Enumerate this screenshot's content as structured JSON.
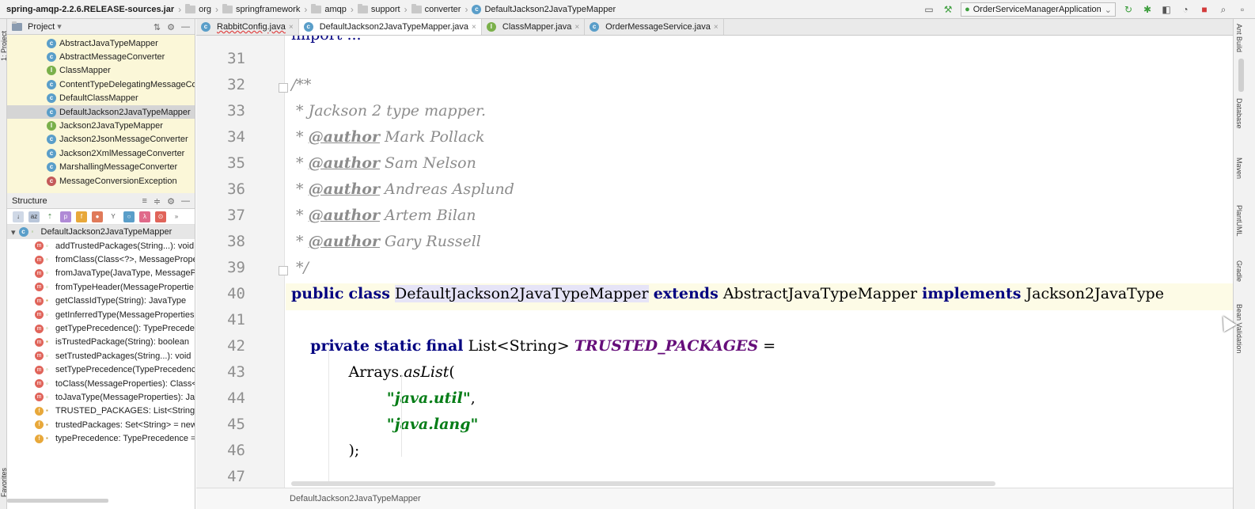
{
  "navbar": {
    "crumbs": [
      "spring-amqp-2.2.6.RELEASE-sources.jar",
      "org",
      "springframework",
      "amqp",
      "support",
      "converter",
      "DefaultJackson2JavaTypeMapper"
    ],
    "run_config": "OrderServiceManagerApplication"
  },
  "left_strip": {
    "top_tab": "1: Project",
    "bottom_tab": "Favorites"
  },
  "project_panel": {
    "title": "Project",
    "items": [
      {
        "label": "AbstractJavaTypeMapper",
        "kind": "class"
      },
      {
        "label": "AbstractMessageConverter",
        "kind": "class"
      },
      {
        "label": "ClassMapper",
        "kind": "interface"
      },
      {
        "label": "ContentTypeDelegatingMessageCon",
        "kind": "class"
      },
      {
        "label": "DefaultClassMapper",
        "kind": "class"
      },
      {
        "label": "DefaultJackson2JavaTypeMapper",
        "kind": "class",
        "selected": true
      },
      {
        "label": "Jackson2JavaTypeMapper",
        "kind": "interface"
      },
      {
        "label": "Jackson2JsonMessageConverter",
        "kind": "class"
      },
      {
        "label": "Jackson2XmlMessageConverter",
        "kind": "class"
      },
      {
        "label": "MarshallingMessageConverter",
        "kind": "class"
      },
      {
        "label": "MessageConversionException",
        "kind": "exception"
      }
    ]
  },
  "structure_panel": {
    "title": "Structure",
    "root": "DefaultJackson2JavaTypeMapper",
    "members": [
      {
        "label": "addTrustedPackages(String...): void",
        "kind": "m",
        "access": "public"
      },
      {
        "label": "fromClass(Class<?>, MessagePrope",
        "kind": "m",
        "access": "public"
      },
      {
        "label": "fromJavaType(JavaType, MessagePr",
        "kind": "m",
        "access": "public"
      },
      {
        "label": "fromTypeHeader(MessagePropertie",
        "kind": "m",
        "access": "public"
      },
      {
        "label": "getClassIdType(String): JavaType",
        "kind": "m",
        "access": "private"
      },
      {
        "label": "getInferredType(MessageProperties",
        "kind": "m",
        "access": "public"
      },
      {
        "label": "getTypePrecedence(): TypePrecedenc",
        "kind": "m",
        "access": "public"
      },
      {
        "label": "isTrustedPackage(String): boolean",
        "kind": "m",
        "access": "private"
      },
      {
        "label": "setTrustedPackages(String...): void",
        "kind": "m",
        "access": "public"
      },
      {
        "label": "setTypePrecedence(TypePrecedence",
        "kind": "m",
        "access": "public"
      },
      {
        "label": "toClass(MessageProperties): Class<",
        "kind": "m",
        "access": "public"
      },
      {
        "label": "toJavaType(MessageProperties): Jav",
        "kind": "m",
        "access": "public"
      },
      {
        "label": "TRUSTED_PACKAGES: List<String> =",
        "kind": "f",
        "access": "private"
      },
      {
        "label": "trustedPackages: Set<String> = new",
        "kind": "f",
        "access": "private"
      },
      {
        "label": "typePrecedence: TypePrecedence =",
        "kind": "f",
        "access": "private"
      }
    ]
  },
  "tabs": [
    {
      "label": "RabbitConfig.java",
      "kind": "class",
      "error": true
    },
    {
      "label": "DefaultJackson2JavaTypeMapper.java",
      "kind": "class",
      "active": true
    },
    {
      "label": "ClassMapper.java",
      "kind": "interface"
    },
    {
      "label": "OrderMessageService.java",
      "kind": "class"
    }
  ],
  "editor": {
    "partial_top_line": "import ...",
    "line_numbers": [
      "31",
      "32",
      "33",
      "34",
      "35",
      "36",
      "37",
      "38",
      "39",
      "40",
      "41",
      "42",
      "43",
      "44",
      "45",
      "46",
      "47"
    ],
    "javadoc_open": "/**",
    "javadoc_desc": " * Jackson 2 type mapper.",
    "author_tag": "@author",
    "authors": [
      "Mark Pollack",
      "Sam Nelson",
      "Andreas Asplund",
      "Artem Bilan",
      "Gary Russell"
    ],
    "javadoc_close": " */",
    "kw_public": "public",
    "kw_class": "class",
    "class_name": "DefaultJackson2JavaTypeMapper",
    "kw_extends": "extends",
    "super_class": "AbstractJavaTypeMapper",
    "kw_implements": "implements",
    "iface": "Jackson2JavaType",
    "kw_private": "private",
    "kw_static": "static",
    "kw_final": "final",
    "field_type": "List<String>",
    "field_name": "TRUSTED_PACKAGES",
    "assign": " =",
    "arrays": "Arrays.",
    "as_list": "asList",
    "open_paren": "(",
    "str1": "\"java.util\"",
    "comma": ",",
    "str2": "\"java.lang\"",
    "close": ");"
  },
  "right_strip": {
    "tabs": [
      "Ant Build",
      "Database",
      "Maven",
      "PlantUML",
      "Gradle",
      "Bean Validation"
    ]
  },
  "bottom_bar": {
    "breadcrumb": "DefaultJackson2JavaTypeMapper"
  }
}
